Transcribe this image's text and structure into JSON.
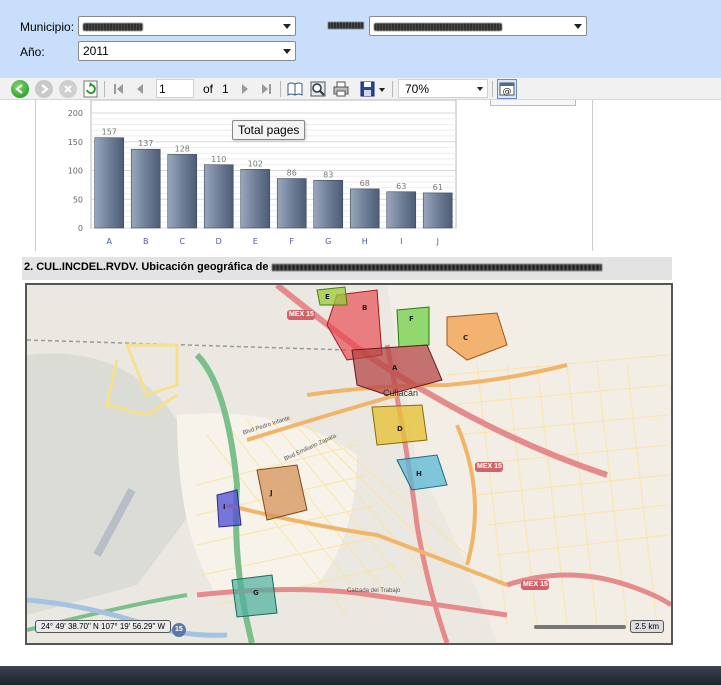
{
  "params": {
    "municipio_label": "Municipio:",
    "municipio_value": "",
    "filter2_label": "",
    "filter2_value": "",
    "anio_label": "Año:",
    "anio_value": "2011"
  },
  "toolbar": {
    "page_current": "1",
    "of_label": "of",
    "page_total": "1",
    "zoom": "70%",
    "tooltip": "Total pages",
    "icons": [
      "back-icon",
      "forward-icon",
      "stop-icon",
      "refresh-icon",
      "first-page-icon",
      "previous-page-icon",
      "next-page-icon",
      "last-page-icon",
      "document-map-icon",
      "find-icon",
      "print-icon",
      "export-icon",
      "send-email-icon"
    ]
  },
  "chart_data": {
    "type": "bar",
    "categories": [
      "A",
      "B",
      "C",
      "D",
      "E",
      "F",
      "G",
      "H",
      "I",
      "J"
    ],
    "values": [
      157,
      137,
      128,
      110,
      102,
      86,
      83,
      68,
      63,
      61
    ],
    "yticks": [
      "200",
      "150",
      "100",
      "50",
      "0"
    ],
    "ylim": [
      0,
      200
    ],
    "grid": true,
    "colors": {
      "bar_top": "#8c9bb0",
      "bar_bottom": "#4d5d75"
    }
  },
  "section2": {
    "title": "2. CUL.INCDEL.RVDV. Ubicación geográfica de"
  },
  "map": {
    "city": "Culiacán",
    "zones": [
      "A",
      "B",
      "C",
      "D",
      "E",
      "F",
      "G",
      "H",
      "I",
      "J"
    ],
    "road_labels": [
      "MEX 15",
      "MEX 15",
      "MEX 15",
      "Blvd Emiliano Zapata",
      "Calzada del Trabajo",
      "Blvd Pedro Infante"
    ],
    "coords": "24° 49' 38.70\" N 107° 19' 56.29\" W",
    "scale": "2.5 km",
    "shield": "15"
  }
}
